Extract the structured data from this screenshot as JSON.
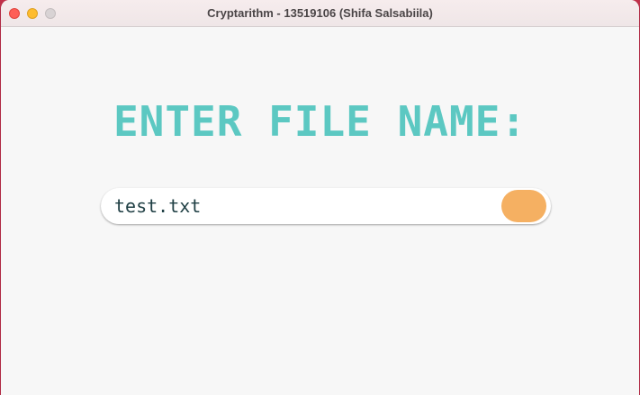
{
  "window": {
    "title": "Cryptarithm - 13519106 (Shifa Salsabiila)"
  },
  "main": {
    "heading": "ENTER FILE NAME:",
    "filename_input": {
      "value": "test.txt"
    },
    "submit_button": {
      "color": "#f5b062"
    }
  },
  "colors": {
    "accent": "#5cc8c2",
    "button": "#f5b062",
    "background": "#f7f7f7"
  }
}
